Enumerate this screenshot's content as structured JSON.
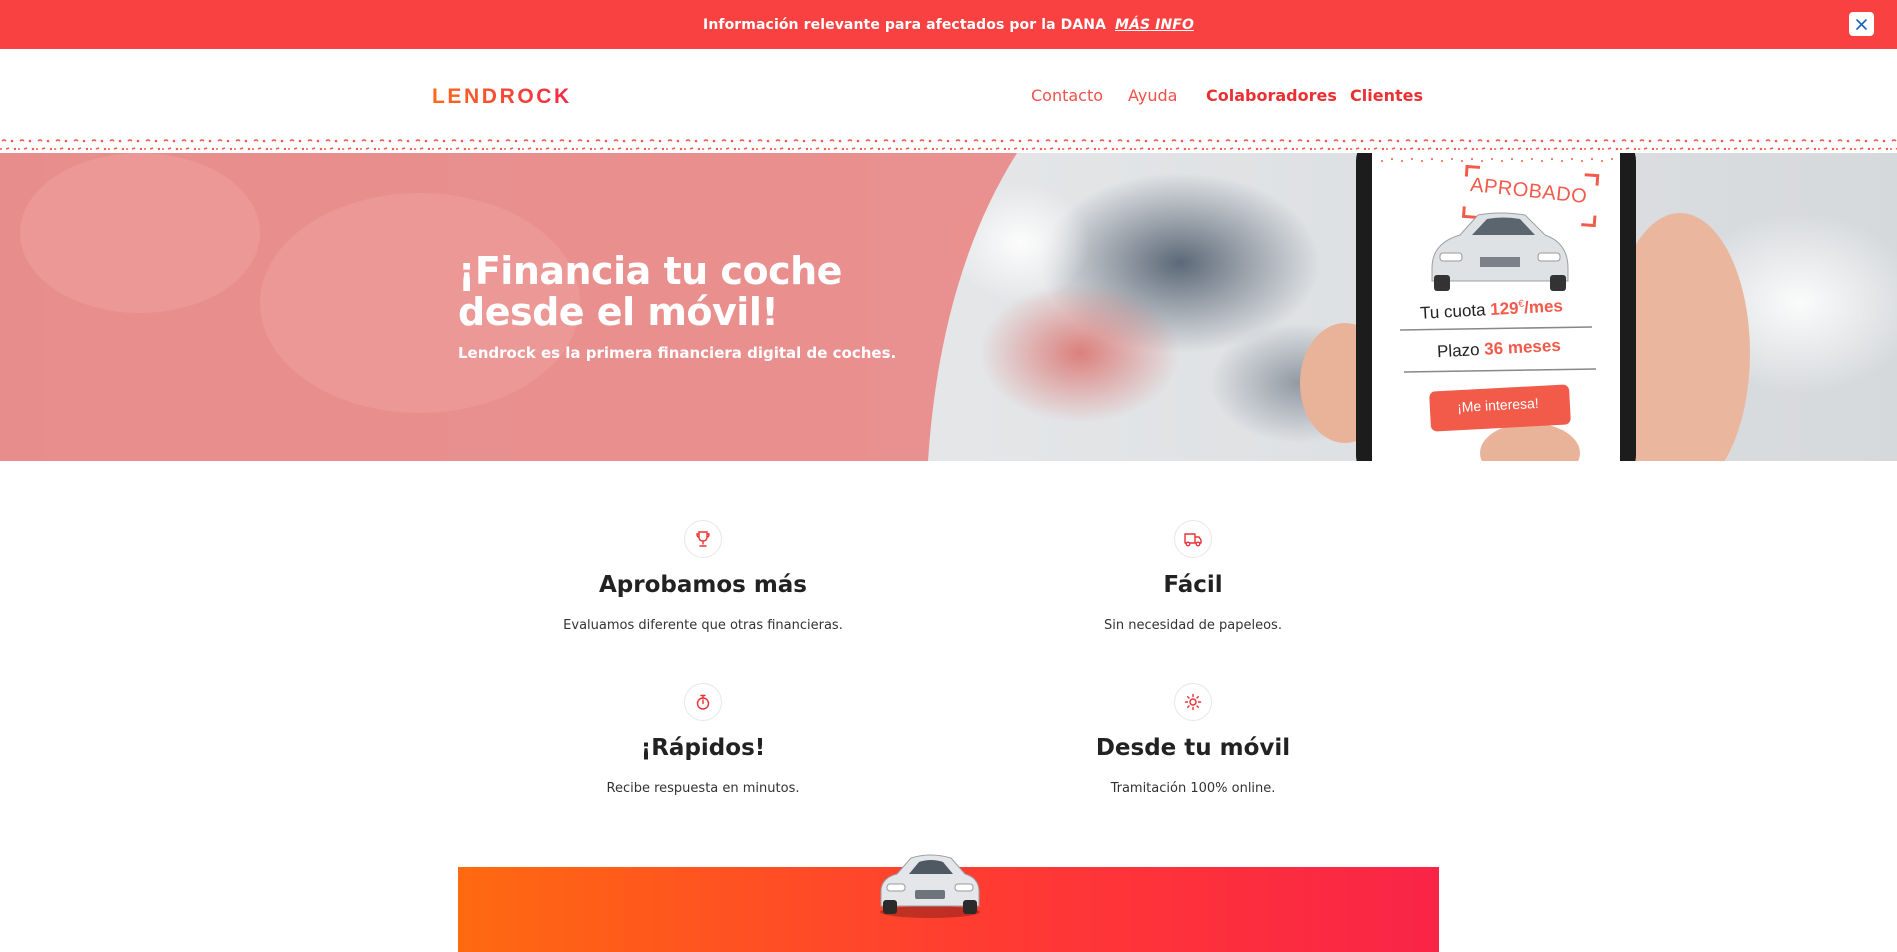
{
  "colors": {
    "brand_red": "#fa4141",
    "nav_red": "#ea3033",
    "logo_orange": "#ff6a1a",
    "logo_pink": "#f0284a",
    "promo_start": "#ff6a10",
    "promo_end": "#fa2447"
  },
  "topbar": {
    "text": "Información relevante para afectados por la DANA",
    "link": "MÁS INFO",
    "close_icon": "close-icon"
  },
  "header": {
    "logo": "LENDROCK",
    "nav": [
      {
        "label": "Contacto"
      },
      {
        "label": "Ayuda"
      },
      {
        "label": "Colaboradores"
      },
      {
        "label": "Clientes"
      }
    ]
  },
  "hero": {
    "title_line1": "¡Financia tu coche",
    "title_line2": "desde el móvil!",
    "subtitle": "Lendrock es la primera financiera digital de coches.",
    "phone": {
      "badge": "APROBADO",
      "cuota_label": "Tu cuota",
      "cuota_value": "129",
      "cuota_unit": "€",
      "cuota_period": "/mes",
      "plazo_label": "Plazo",
      "plazo_value": "36 meses",
      "button": "¡Me interesa!"
    }
  },
  "features": [
    {
      "icon": "trophy-icon",
      "title": "Aprobamos más",
      "text": "Evaluamos diferente que otras financieras."
    },
    {
      "icon": "truck-icon",
      "title": "Fácil",
      "text": "Sin necesidad de papeleos."
    },
    {
      "icon": "stopwatch-icon",
      "title": "¡Rápidos!",
      "text": "Recibe respuesta en minutos."
    },
    {
      "icon": "sun-icon",
      "title": "Desde tu móvil",
      "text": "Tramitación 100% online."
    }
  ]
}
